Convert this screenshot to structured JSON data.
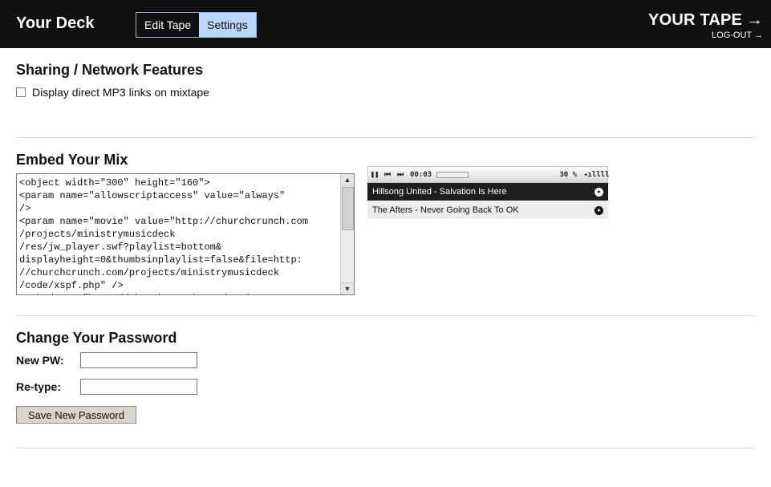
{
  "header": {
    "brand": "Your Deck",
    "tabs": [
      {
        "label": "Edit Tape",
        "active": false
      },
      {
        "label": "Settings",
        "active": true
      }
    ],
    "tape_title": "YOUR TAPE →",
    "logout": "LOG-OUT →"
  },
  "sharing": {
    "title": "Sharing / Network Features",
    "checkbox_label": "Display direct MP3 links on mixtape",
    "checked": false
  },
  "embed": {
    "title": "Embed Your Mix",
    "code": "<object width=\"300\" height=\"160\">\n<param name=\"allowscriptaccess\" value=\"always\"\n/>\n<param name=\"movie\" value=\"http://churchcrunch.com\n/projects/ministrymusicdeck\n/res/jw_player.swf?playlist=bottom&\ndisplayheight=0&thumbsinplaylist=false&file=http:\n//churchcrunch.com/projects/ministrymusicdeck\n/code/xspf.php\" />\n<embed src=\"http://churchcrunch.com/project"
  },
  "player": {
    "time": "00:03",
    "volume": "30 %",
    "tracks": [
      {
        "title": "Hillsong United - Salvation Is Here",
        "playing": true
      },
      {
        "title": "The Afters - Never Going Back To OK",
        "playing": false
      }
    ]
  },
  "password": {
    "title": "Change Your Password",
    "new_label": "New PW:",
    "new_value": "",
    "retype_label": "Re-type:",
    "retype_value": "",
    "save_label": "Save New Password"
  },
  "colors": {
    "header_bg": "#111111",
    "active_tab": "#b9d6ff",
    "divider": "#dddddd"
  }
}
